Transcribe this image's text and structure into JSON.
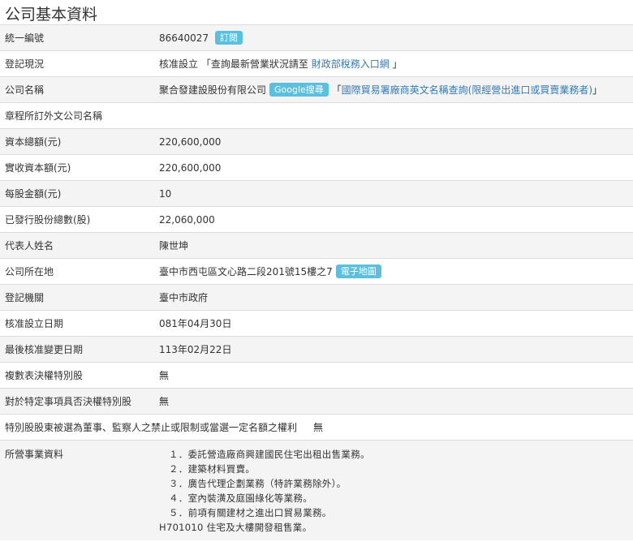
{
  "page_title": "公司基本資料",
  "colors": {
    "badge_bg": "#5bc0de",
    "link": "#337ab7",
    "row_shade": "#f4f4f4"
  },
  "rows": {
    "unified_id": {
      "label": "統一編號",
      "value": "86640027",
      "subscribe_label": "訂閱"
    },
    "status": {
      "label": "登記現況",
      "value": "核准設立",
      "pre_link": "「查詢最新營業狀況請至",
      "link": "財政部稅務入口網",
      "post_link": "」"
    },
    "company_name": {
      "label": "公司名稱",
      "value": "聚合發建設股份有限公司",
      "google_label": "Google搜尋",
      "pre_link": "「",
      "link": "國際貿易署廠商英文名稱查詢(限經營出進口或買賣業務者)",
      "post_link": "」"
    },
    "foreign_name": {
      "label": "章程所訂外文公司名稱",
      "value": ""
    },
    "capital_total": {
      "label": "資本總額(元)",
      "value": "220,600,000"
    },
    "capital_paid": {
      "label": "實收資本額(元)",
      "value": "220,600,000"
    },
    "par_value": {
      "label": "每股金額(元)",
      "value": "10"
    },
    "shares_issued": {
      "label": "已發行股份總數(股)",
      "value": "22,060,000"
    },
    "representative": {
      "label": "代表人姓名",
      "value": "陳世坤"
    },
    "address": {
      "label": "公司所在地",
      "value": "臺中市西屯區文心路二段201號15樓之7",
      "map_label": "電子地圖"
    },
    "authority": {
      "label": "登記機關",
      "value": "臺中市政府"
    },
    "approval_date": {
      "label": "核准設立日期",
      "value": "081年04月30日"
    },
    "last_change_date": {
      "label": "最後核准變更日期",
      "value": "113年02月22日"
    },
    "multi_vote": {
      "label": "複數表決權特別股",
      "value": "無"
    },
    "veto_share": {
      "label": "對於特定事項具否決權特別股",
      "value": "無"
    },
    "director_restriction": {
      "label": "特別股股東被選為董事、監察人之禁止或限制或當選一定名額之權利",
      "value": "無"
    },
    "business": {
      "label": "所營事業資料",
      "items": [
        "１．委託營造廠商興建國民住宅出租出售業務。",
        "２．建築材料買賣。",
        "３．廣告代理企劃業務（特許業務除外）。",
        "４．室內裝潢及庭園綠化等業務。",
        "５．前項有關建材之進出口貿易業務。",
        "H701010  住宅及大樓開發租售業。"
      ]
    }
  }
}
